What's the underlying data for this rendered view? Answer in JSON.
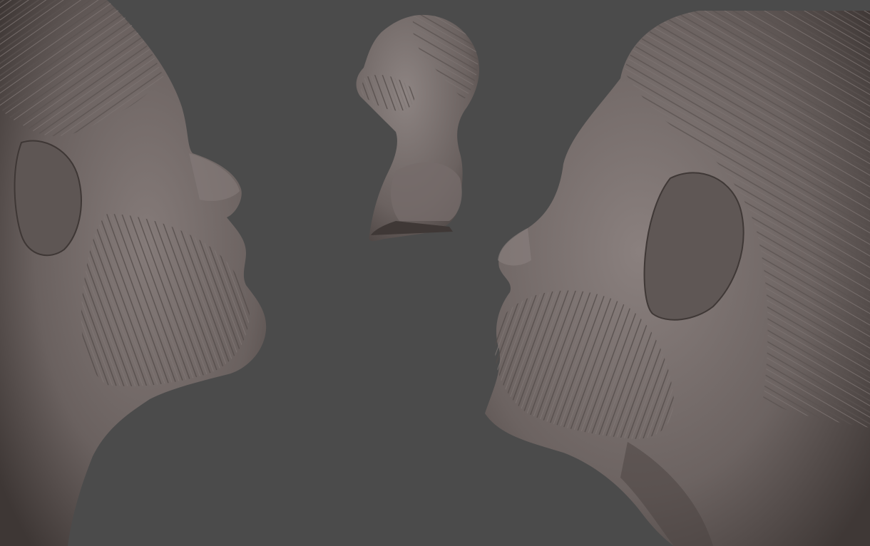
{
  "viewport": {
    "background_color": "#4b4b4b",
    "clay_color": "#6e6462",
    "clay_shadow_color": "#3f3836",
    "clay_highlight_color": "#8c8381"
  },
  "views": [
    {
      "id": "view-left",
      "subject": "sculpt-bust-closeup",
      "facing": "right"
    },
    {
      "id": "view-center",
      "subject": "sculpt-bust-full",
      "facing": "left"
    },
    {
      "id": "view-right",
      "subject": "sculpt-bust-closeup",
      "facing": "left"
    }
  ]
}
